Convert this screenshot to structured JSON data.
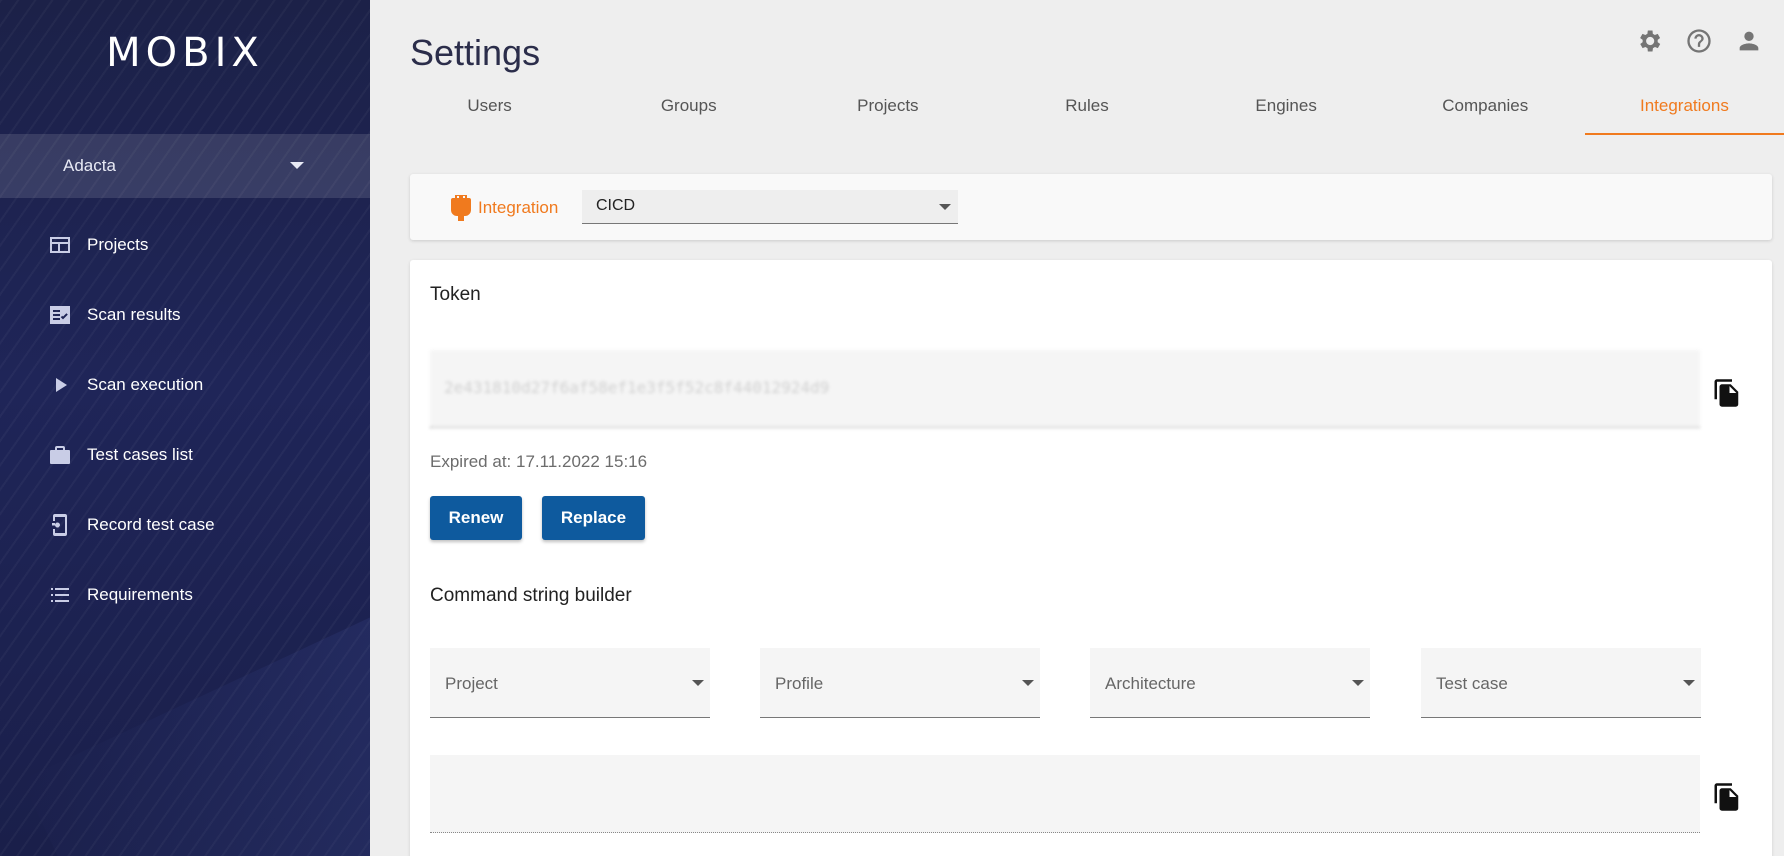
{
  "sidebar": {
    "logo": "MOBIX",
    "company": "Adacta",
    "items": [
      {
        "label": "Projects",
        "icon": "projects-icon"
      },
      {
        "label": "Scan results",
        "icon": "scan-results-icon"
      },
      {
        "label": "Scan execution",
        "icon": "play-icon"
      },
      {
        "label": "Test cases list",
        "icon": "briefcase-icon"
      },
      {
        "label": "Record test case",
        "icon": "record-phone-icon"
      },
      {
        "label": "Requirements",
        "icon": "list-icon"
      }
    ]
  },
  "header": {
    "title": "Settings",
    "icons": [
      "gear-icon",
      "help-icon",
      "account-icon"
    ]
  },
  "tabs": [
    {
      "label": "Users"
    },
    {
      "label": "Groups"
    },
    {
      "label": "Projects"
    },
    {
      "label": "Rules"
    },
    {
      "label": "Engines"
    },
    {
      "label": "Companies"
    },
    {
      "label": "Integrations",
      "active": true
    }
  ],
  "integration": {
    "label": "Integration",
    "selected": "CICD"
  },
  "token": {
    "title": "Token",
    "value": "2e431810d27f6af58ef1e3f5f52c8f44012924d9",
    "expired": "Expired at: 17.11.2022 15:16",
    "renew_label": "Renew",
    "replace_label": "Replace"
  },
  "builder": {
    "title": "Command string builder",
    "dropdowns": [
      {
        "label": "Project"
      },
      {
        "label": "Profile"
      },
      {
        "label": "Architecture"
      },
      {
        "label": "Test case"
      }
    ],
    "command": ""
  },
  "colors": {
    "accent": "#f07a1e",
    "primary_button": "#0e5a9e",
    "sidebar_bg": "#1f2558"
  }
}
